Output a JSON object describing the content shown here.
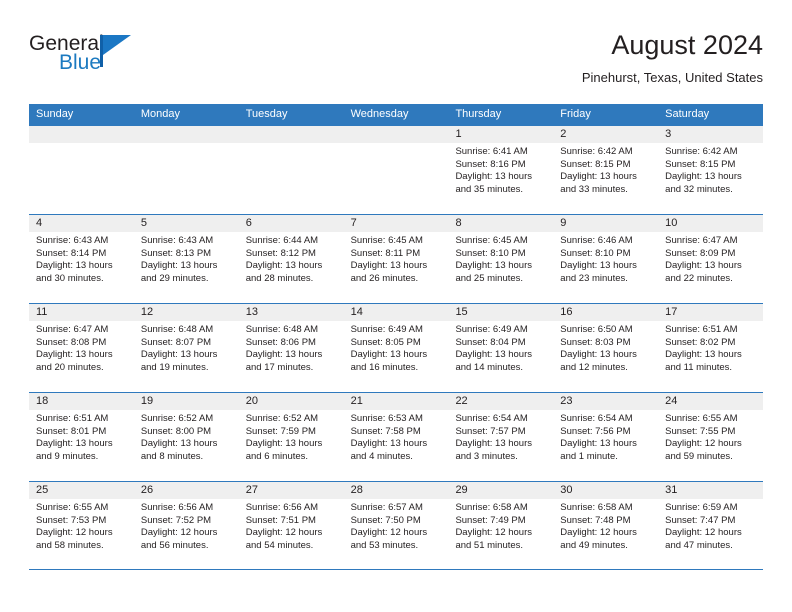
{
  "logo": {
    "word_top": "General",
    "word_bottom": "Blue",
    "accent_color": "#1b77c4"
  },
  "header": {
    "title": "August 2024",
    "subtitle": "Pinehurst, Texas, United States"
  },
  "theme": {
    "header_blue": "#2f79bd",
    "day_band_gray": "#efefef",
    "text": "#231f20"
  },
  "calendar": {
    "weekday_headers": [
      "Sunday",
      "Monday",
      "Tuesday",
      "Wednesday",
      "Thursday",
      "Friday",
      "Saturday"
    ],
    "weeks": [
      [
        {
          "day": "",
          "sunrise": "",
          "sunset": "",
          "daylight": "",
          "empty": true
        },
        {
          "day": "",
          "sunrise": "",
          "sunset": "",
          "daylight": "",
          "empty": true
        },
        {
          "day": "",
          "sunrise": "",
          "sunset": "",
          "daylight": "",
          "empty": true
        },
        {
          "day": "",
          "sunrise": "",
          "sunset": "",
          "daylight": "",
          "empty": true
        },
        {
          "day": "1",
          "sunrise": "Sunrise: 6:41 AM",
          "sunset": "Sunset: 8:16 PM",
          "daylight": "Daylight: 13 hours and 35 minutes."
        },
        {
          "day": "2",
          "sunrise": "Sunrise: 6:42 AM",
          "sunset": "Sunset: 8:15 PM",
          "daylight": "Daylight: 13 hours and 33 minutes."
        },
        {
          "day": "3",
          "sunrise": "Sunrise: 6:42 AM",
          "sunset": "Sunset: 8:15 PM",
          "daylight": "Daylight: 13 hours and 32 minutes."
        }
      ],
      [
        {
          "day": "4",
          "sunrise": "Sunrise: 6:43 AM",
          "sunset": "Sunset: 8:14 PM",
          "daylight": "Daylight: 13 hours and 30 minutes."
        },
        {
          "day": "5",
          "sunrise": "Sunrise: 6:43 AM",
          "sunset": "Sunset: 8:13 PM",
          "daylight": "Daylight: 13 hours and 29 minutes."
        },
        {
          "day": "6",
          "sunrise": "Sunrise: 6:44 AM",
          "sunset": "Sunset: 8:12 PM",
          "daylight": "Daylight: 13 hours and 28 minutes."
        },
        {
          "day": "7",
          "sunrise": "Sunrise: 6:45 AM",
          "sunset": "Sunset: 8:11 PM",
          "daylight": "Daylight: 13 hours and 26 minutes."
        },
        {
          "day": "8",
          "sunrise": "Sunrise: 6:45 AM",
          "sunset": "Sunset: 8:10 PM",
          "daylight": "Daylight: 13 hours and 25 minutes."
        },
        {
          "day": "9",
          "sunrise": "Sunrise: 6:46 AM",
          "sunset": "Sunset: 8:10 PM",
          "daylight": "Daylight: 13 hours and 23 minutes."
        },
        {
          "day": "10",
          "sunrise": "Sunrise: 6:47 AM",
          "sunset": "Sunset: 8:09 PM",
          "daylight": "Daylight: 13 hours and 22 minutes."
        }
      ],
      [
        {
          "day": "11",
          "sunrise": "Sunrise: 6:47 AM",
          "sunset": "Sunset: 8:08 PM",
          "daylight": "Daylight: 13 hours and 20 minutes."
        },
        {
          "day": "12",
          "sunrise": "Sunrise: 6:48 AM",
          "sunset": "Sunset: 8:07 PM",
          "daylight": "Daylight: 13 hours and 19 minutes."
        },
        {
          "day": "13",
          "sunrise": "Sunrise: 6:48 AM",
          "sunset": "Sunset: 8:06 PM",
          "daylight": "Daylight: 13 hours and 17 minutes."
        },
        {
          "day": "14",
          "sunrise": "Sunrise: 6:49 AM",
          "sunset": "Sunset: 8:05 PM",
          "daylight": "Daylight: 13 hours and 16 minutes."
        },
        {
          "day": "15",
          "sunrise": "Sunrise: 6:49 AM",
          "sunset": "Sunset: 8:04 PM",
          "daylight": "Daylight: 13 hours and 14 minutes."
        },
        {
          "day": "16",
          "sunrise": "Sunrise: 6:50 AM",
          "sunset": "Sunset: 8:03 PM",
          "daylight": "Daylight: 13 hours and 12 minutes."
        },
        {
          "day": "17",
          "sunrise": "Sunrise: 6:51 AM",
          "sunset": "Sunset: 8:02 PM",
          "daylight": "Daylight: 13 hours and 11 minutes."
        }
      ],
      [
        {
          "day": "18",
          "sunrise": "Sunrise: 6:51 AM",
          "sunset": "Sunset: 8:01 PM",
          "daylight": "Daylight: 13 hours and 9 minutes."
        },
        {
          "day": "19",
          "sunrise": "Sunrise: 6:52 AM",
          "sunset": "Sunset: 8:00 PM",
          "daylight": "Daylight: 13 hours and 8 minutes."
        },
        {
          "day": "20",
          "sunrise": "Sunrise: 6:52 AM",
          "sunset": "Sunset: 7:59 PM",
          "daylight": "Daylight: 13 hours and 6 minutes."
        },
        {
          "day": "21",
          "sunrise": "Sunrise: 6:53 AM",
          "sunset": "Sunset: 7:58 PM",
          "daylight": "Daylight: 13 hours and 4 minutes."
        },
        {
          "day": "22",
          "sunrise": "Sunrise: 6:54 AM",
          "sunset": "Sunset: 7:57 PM",
          "daylight": "Daylight: 13 hours and 3 minutes."
        },
        {
          "day": "23",
          "sunrise": "Sunrise: 6:54 AM",
          "sunset": "Sunset: 7:56 PM",
          "daylight": "Daylight: 13 hours and 1 minute."
        },
        {
          "day": "24",
          "sunrise": "Sunrise: 6:55 AM",
          "sunset": "Sunset: 7:55 PM",
          "daylight": "Daylight: 12 hours and 59 minutes."
        }
      ],
      [
        {
          "day": "25",
          "sunrise": "Sunrise: 6:55 AM",
          "sunset": "Sunset: 7:53 PM",
          "daylight": "Daylight: 12 hours and 58 minutes."
        },
        {
          "day": "26",
          "sunrise": "Sunrise: 6:56 AM",
          "sunset": "Sunset: 7:52 PM",
          "daylight": "Daylight: 12 hours and 56 minutes."
        },
        {
          "day": "27",
          "sunrise": "Sunrise: 6:56 AM",
          "sunset": "Sunset: 7:51 PM",
          "daylight": "Daylight: 12 hours and 54 minutes."
        },
        {
          "day": "28",
          "sunrise": "Sunrise: 6:57 AM",
          "sunset": "Sunset: 7:50 PM",
          "daylight": "Daylight: 12 hours and 53 minutes."
        },
        {
          "day": "29",
          "sunrise": "Sunrise: 6:58 AM",
          "sunset": "Sunset: 7:49 PM",
          "daylight": "Daylight: 12 hours and 51 minutes."
        },
        {
          "day": "30",
          "sunrise": "Sunrise: 6:58 AM",
          "sunset": "Sunset: 7:48 PM",
          "daylight": "Daylight: 12 hours and 49 minutes."
        },
        {
          "day": "31",
          "sunrise": "Sunrise: 6:59 AM",
          "sunset": "Sunset: 7:47 PM",
          "daylight": "Daylight: 12 hours and 47 minutes."
        }
      ]
    ]
  }
}
